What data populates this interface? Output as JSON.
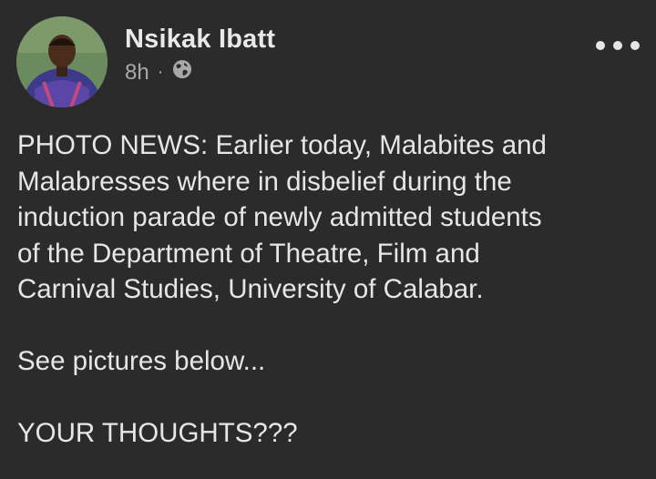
{
  "post": {
    "author": "Nsikak Ibatt",
    "time": "8h",
    "separator": "·",
    "audience_icon": "globe-icon",
    "menu_icon": "more-options-icon",
    "lines": [
      "PHOTO NEWS: Earlier today, Malabites and",
      "Malabresses where in disbelief during the",
      "induction parade of newly admitted students",
      "of the Department of Theatre, Film and",
      "Carnival Studies, University of Calabar."
    ],
    "line_2": "See pictures below...",
    "line_3": "YOUR THOUGHTS???"
  },
  "colors": {
    "background": "#2b2b2c",
    "text": "#e6e6e6",
    "secondary_text": "#a8a8a8"
  }
}
